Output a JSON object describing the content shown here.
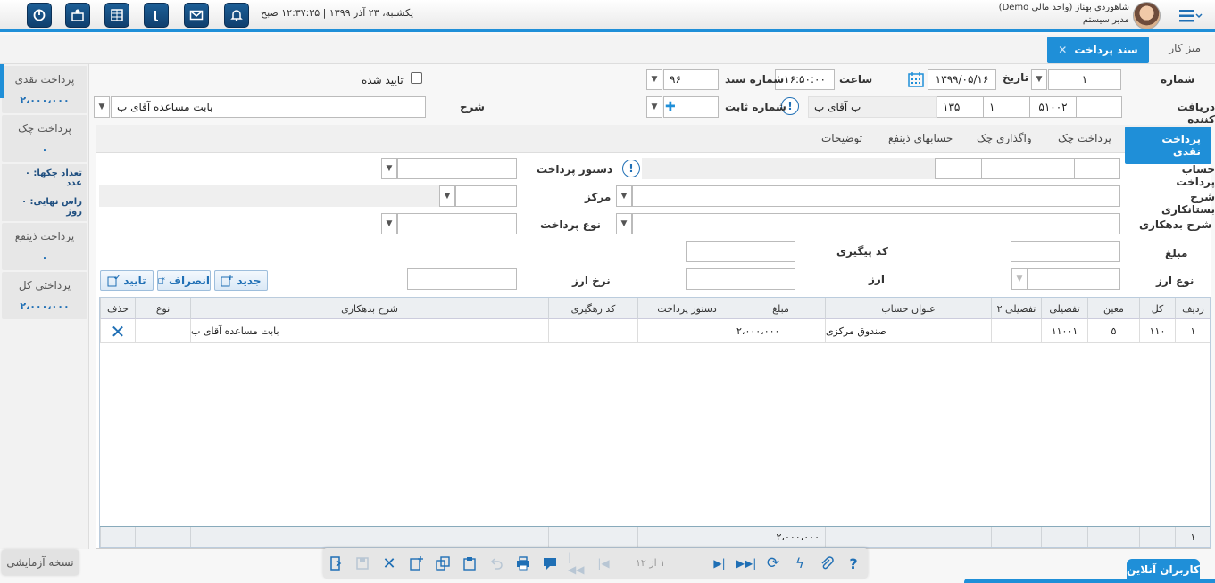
{
  "header": {
    "datetime": "یکشنبه، ۲۳ آذر ۱۳۹۹ | ۱۲:۳۷:۳۵ صبح",
    "user_name": "شاهوردی بهناز (واحد مالی Demo)",
    "user_role": "مدیر سیستم",
    "icons": [
      "power-icon",
      "user-card-icon",
      "dashboard-icon",
      "info-icon",
      "mail-icon",
      "bell-icon"
    ]
  },
  "tabs": {
    "desk": "میز کار",
    "active": "سند پرداخت"
  },
  "sidebar": {
    "cash_title": "پرداخت نقدی",
    "cash_value": "۲،۰۰۰،۰۰۰",
    "check_title": "پرداخت چک",
    "check_value": "۰",
    "check_count": "تعداد چکها: ۰ عدد",
    "due": "راس نهایی: ۰ روز",
    "beneficiary_title": "پرداخت ذینفع",
    "beneficiary_value": "۰",
    "total_title": "پرداختی کل",
    "total_value": "۲،۰۰۰،۰۰۰"
  },
  "form": {
    "number_label": "شماره",
    "number_value": "۱",
    "date_label": "تاریخ",
    "date_value": "۱۳۹۹/۰۵/۱۶",
    "time_label": "ساعت",
    "time_value": "۱۶:۵۰:۰۰",
    "doc_label": "شماره سند",
    "doc_value": "۹۶",
    "approved_label": "تایید شده",
    "receiver_label": "دریافت کننده",
    "receiver_code1": "۵۱۰۰۲",
    "receiver_code2": "۱",
    "receiver_code3": "۱۳۵",
    "receiver_name": "ب آقای ب",
    "fixed_label": "شماره ثابت",
    "desc_label": "شرح",
    "desc_value": "بابت مساعده آقای ب"
  },
  "panel_tabs": [
    "پرداخت نقدی",
    "پرداخت چک",
    "واگذاری چک",
    "حسابهای ذینفع",
    "توضیحات"
  ],
  "detail": {
    "account_label": "حساب پرداخت",
    "order_label": "دستور پرداخت",
    "credit_desc_label": "شرح بستانکاری",
    "center_label": "مرکز",
    "debit_desc_label": "شرح بدهکاری",
    "pay_type_label": "نوع پرداخت",
    "amount_label": "مبلغ",
    "tracking_label": "کد پیگیری",
    "currency_type_label": "نوع ارز",
    "currency_label": "ارز",
    "rate_label": "نرخ ارز",
    "btn_new": "جدید",
    "btn_cancel": "انصراف",
    "btn_confirm": "تایید"
  },
  "grid": {
    "columns": [
      "ردیف",
      "کل",
      "معین",
      "تفصیلی",
      "تفصیلی ۲",
      "عنوان حساب",
      "مبلغ",
      "دستور پرداخت",
      "کد رهگیری",
      "شرح بدهکاری",
      "نوع",
      "حذف"
    ],
    "rows": [
      {
        "row": "۱",
        "kol": "۱۱۰",
        "moein": "۵",
        "tafsili": "۱۱۰۰۱",
        "tafsili2": "",
        "title": "صندوق مرکزی",
        "amount": "۲،۰۰۰،۰۰۰",
        "order": "",
        "tracking": "",
        "desc": "بابت مساعده آقای ب",
        "type": ""
      }
    ],
    "footer_row": "۱",
    "footer_amount": "۲،۰۰۰،۰۰۰"
  },
  "toolbar": {
    "pager": "۱ از ۱۲"
  },
  "footer": {
    "trial": "نسخه آزمایشی",
    "online_users": "کاربران آنلاین"
  },
  "colors": {
    "accent": "#1f8fd8",
    "header_button": "#1d5f97"
  }
}
